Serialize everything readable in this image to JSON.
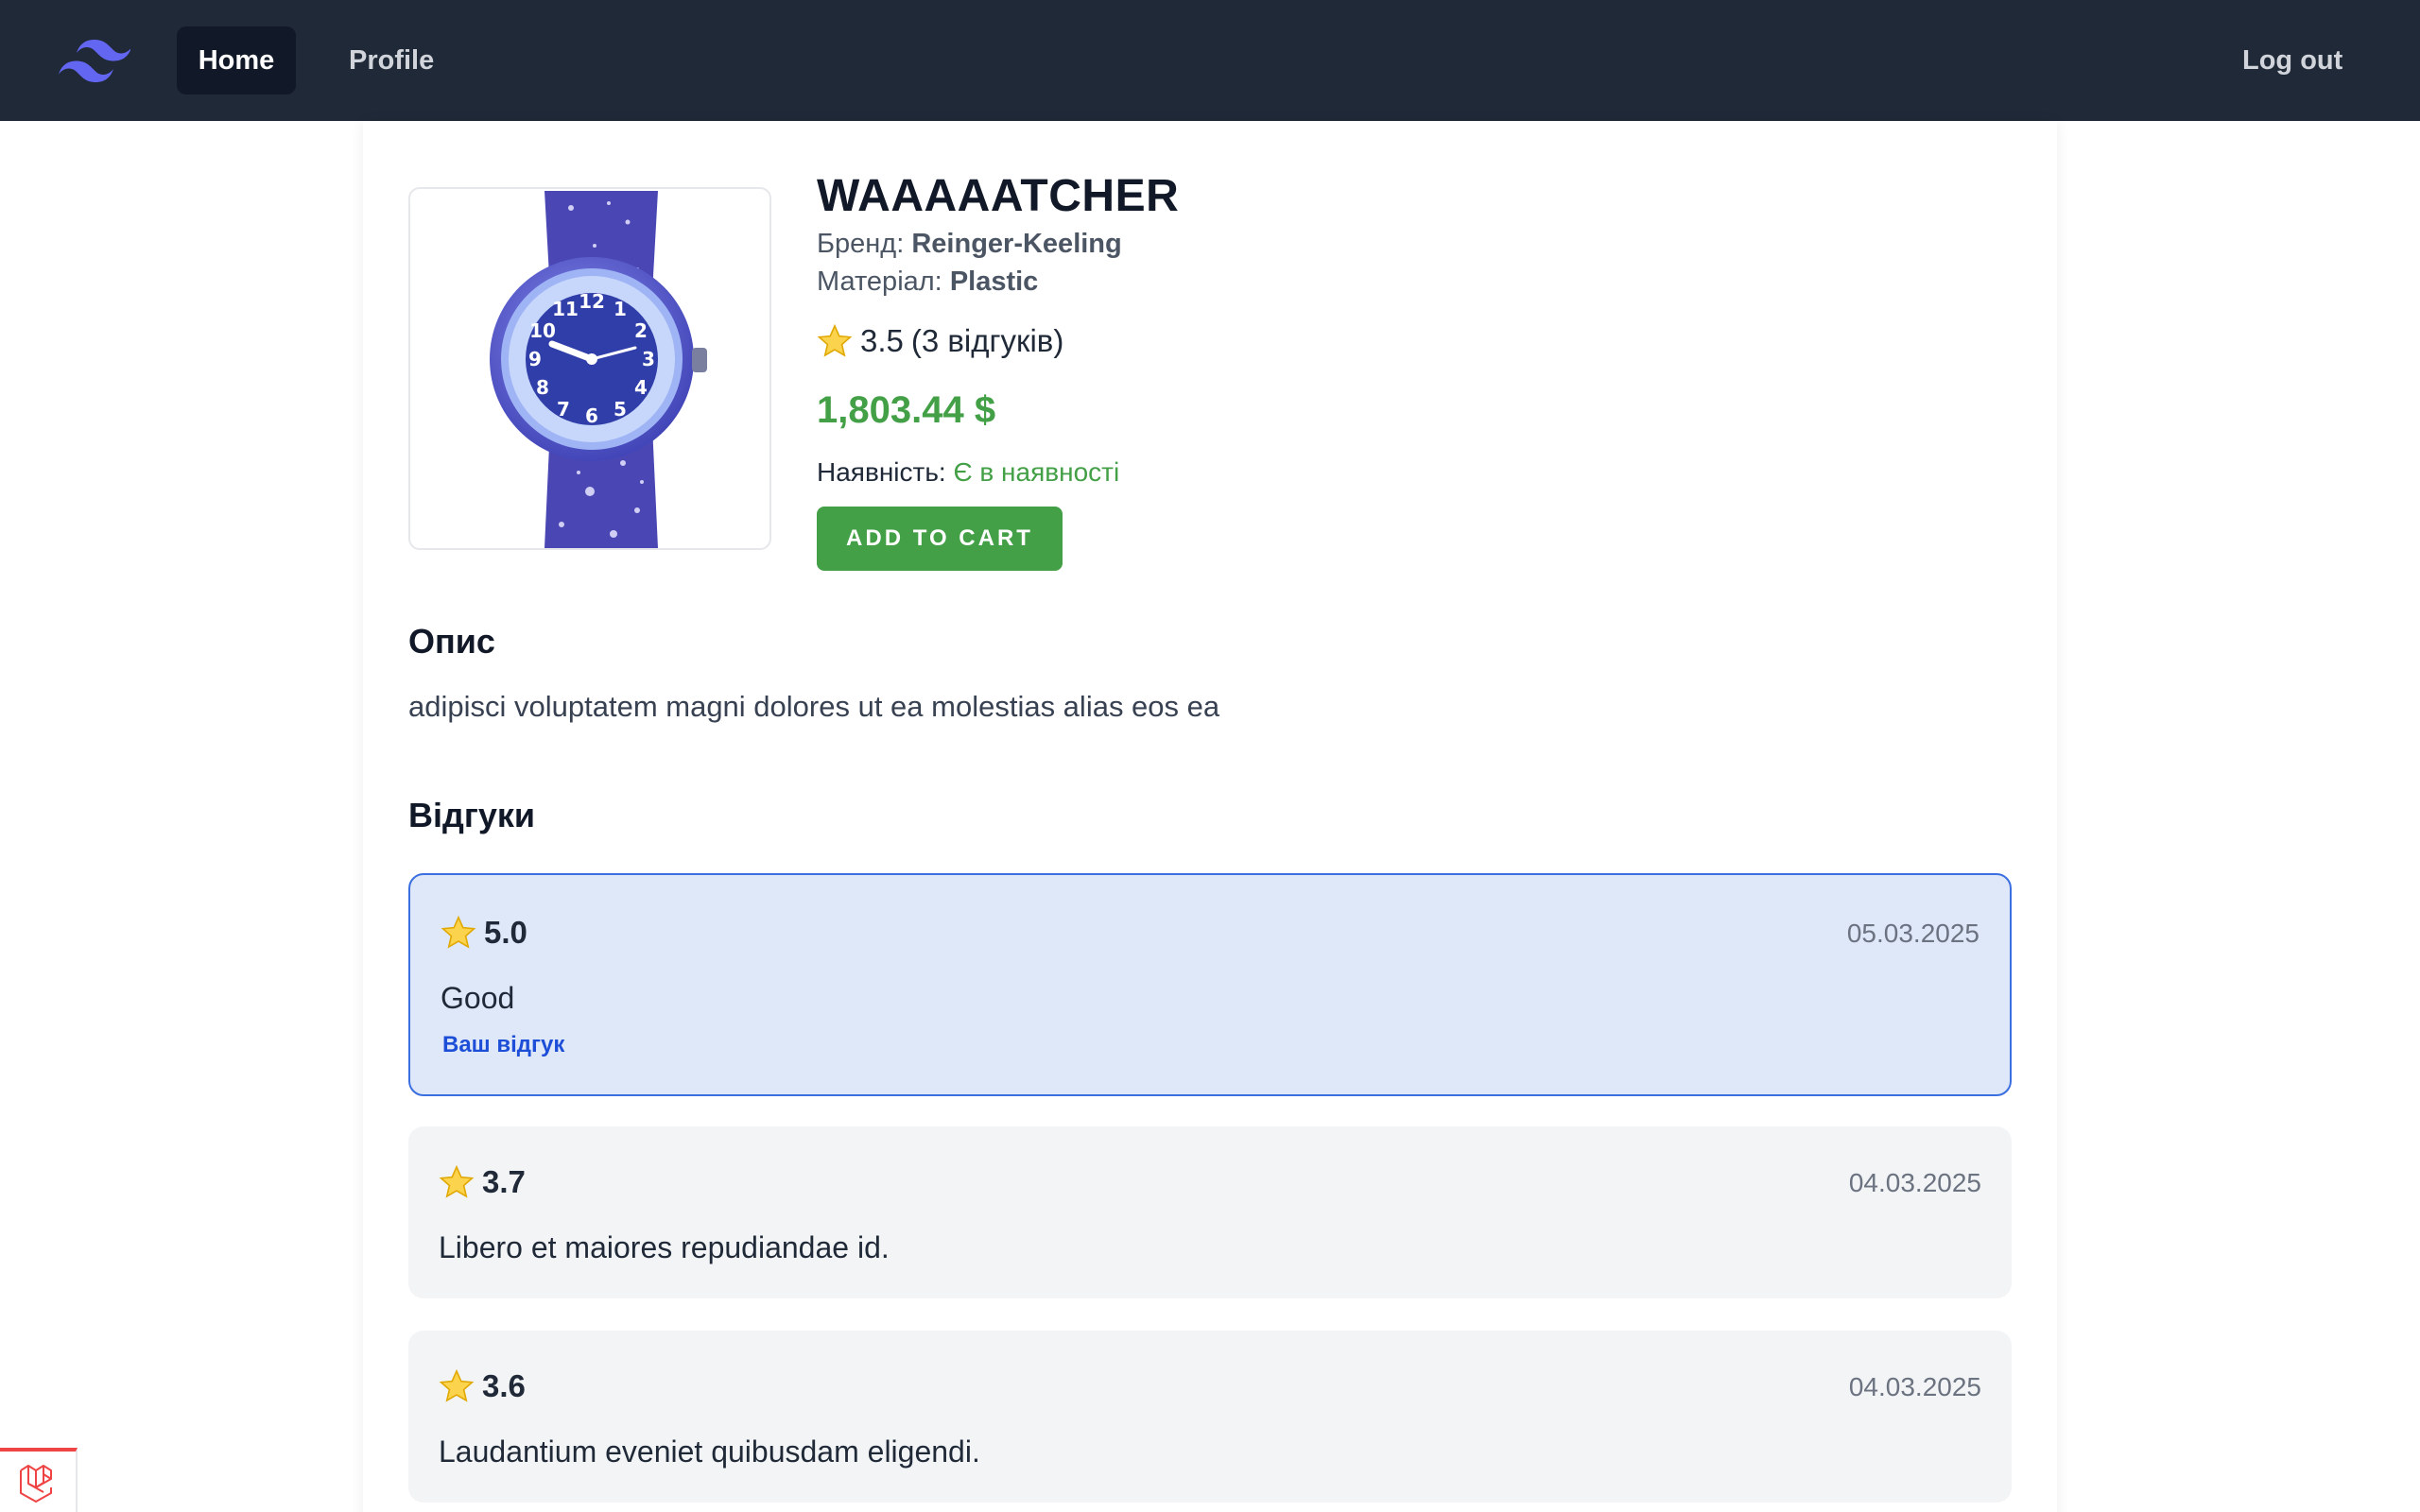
{
  "nav": {
    "home": "Home",
    "profile": "Profile",
    "logout": "Log out",
    "logo_icon": "tailwind-logo-icon"
  },
  "product": {
    "title": "WAAAAATCHER",
    "brand_label": "Бренд:",
    "brand": "Reinger-Keeling",
    "material_label": "Матеріал:",
    "material": "Plastic",
    "rating": "3.5",
    "rating_count": "(3 відгуків)",
    "price": "1,803.44 $",
    "availability_label": "Наявність:",
    "availability_value": "Є в наявності",
    "add_to_cart": "ADD TO CART",
    "image_icon": "wristwatch-image"
  },
  "description": {
    "heading": "Опис",
    "text": "adipisci voluptatem magni dolores ut ea molestias alias eos ea"
  },
  "reviews": {
    "heading": "Відгуки",
    "items": [
      {
        "rating": "5.0",
        "date": "05.03.2025",
        "text": "Good",
        "badge": "Ваш відгук"
      },
      {
        "rating": "3.7",
        "date": "04.03.2025",
        "text": "Libero et maiores repudiandae id."
      },
      {
        "rating": "3.6",
        "date": "04.03.2025",
        "text": "Laudantium eveniet quibusdam eligendi."
      }
    ]
  },
  "colors": {
    "navbar": "#1f2937",
    "accent_green": "#43a047",
    "own_review_bg": "#dfe8f9",
    "own_review_border": "#3b6fe0"
  },
  "debug_badge_icon": "laravel-icon"
}
